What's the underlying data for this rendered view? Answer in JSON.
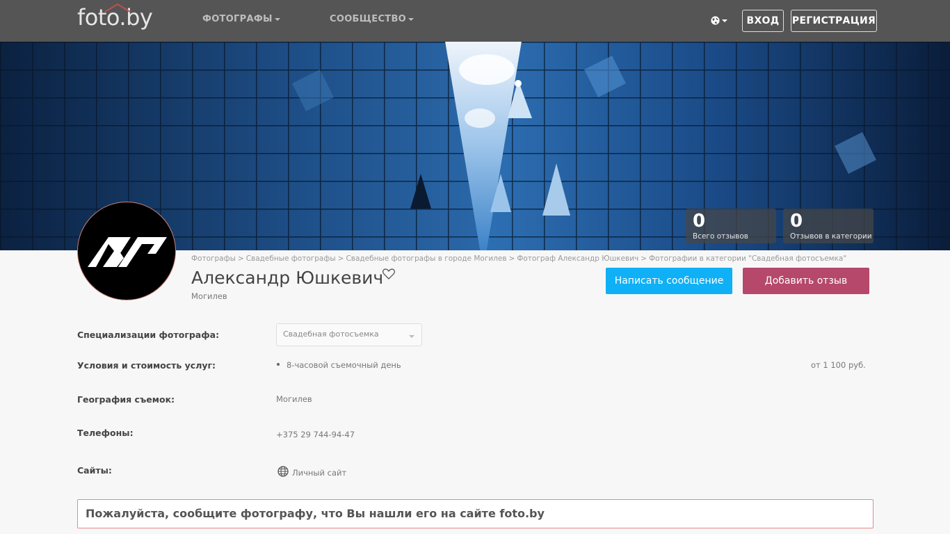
{
  "header": {
    "logo": "foto.by",
    "nav": [
      {
        "label": "ФОТОГРАФЫ"
      },
      {
        "label": "СООБЩЕСТВО"
      }
    ],
    "login_label": "ВХОД",
    "register_label": "РЕГИСТРАЦИЯ"
  },
  "stats": [
    {
      "value": "0",
      "label": "Всего отзывов"
    },
    {
      "value": "0",
      "label": "Отзывов в категории"
    }
  ],
  "breadcrumb": [
    "Фотографы",
    "Свадебные фотографы",
    "Свадебные фотографы в городе Могилев",
    "Фотограф Александр Юшкевич",
    "Фотографии в категории \"Свадебная фотосъемка\""
  ],
  "profile": {
    "name": "Александр Юшкевич",
    "city": "Могилев",
    "message_button": "Написать сообщение",
    "review_button": "Добавить отзыв"
  },
  "details": {
    "specializations_label": "Специализации фотографа:",
    "specialization_selected": "Свадебная фотосъемка",
    "terms_label": "Условия и стоимость услуг:",
    "terms_item": "8-часовой съемочный день",
    "terms_price": "от 1 100 руб.",
    "geography_label": "География съемок:",
    "geography_value": "Могилев",
    "phones_label": "Телефоны:",
    "phone": "+375 29 744-94-47",
    "sites_label": "Сайты:",
    "site_link": "Личный сайт"
  },
  "notice": "Пожалуйста, сообщите фотографу, что Вы нашли его на сайте foto.by",
  "colors": {
    "header_bg": "#555555",
    "message_button": "#0fb0f5",
    "review_button": "#b5486b",
    "notice_border": "#e6888a"
  }
}
